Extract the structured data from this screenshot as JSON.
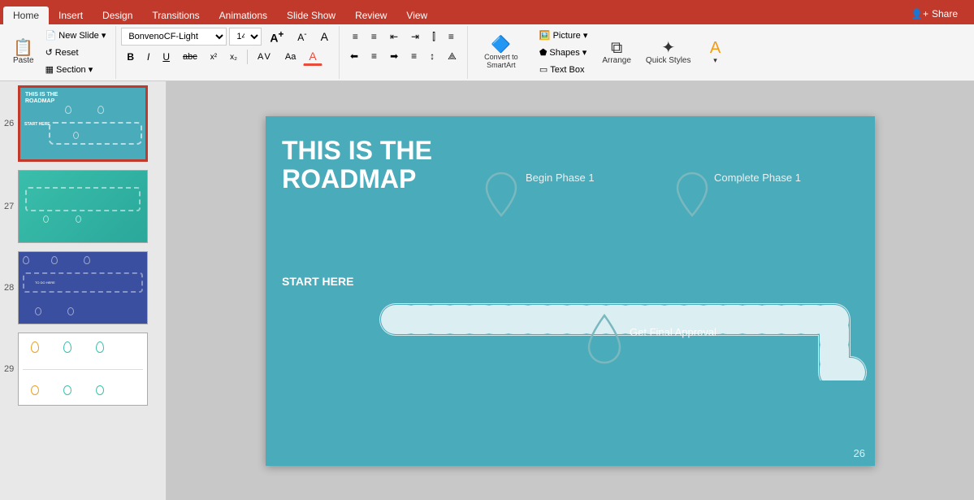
{
  "ribbon": {
    "tabs": [
      "Home",
      "Insert",
      "Design",
      "Transitions",
      "Animations",
      "Slide Show",
      "Review",
      "View"
    ],
    "active_tab": "Home",
    "share_label": "Share"
  },
  "toolbar": {
    "clipboard_group": {
      "paste_label": "Paste",
      "new_slide_label": "New Slide",
      "reset_label": "Reset",
      "section_label": "Section"
    },
    "font_group": {
      "font_name": "BonvenoCF-Light",
      "font_size": "14",
      "font_size_up": "A↑",
      "font_size_down": "A↓",
      "clear_format": "A",
      "bold": "B",
      "italic": "I",
      "underline": "U",
      "strikethrough": "abc",
      "superscript": "x²",
      "subscript": "x₂",
      "char_spacing": "AV",
      "text_case": "Aa",
      "font_color": "A"
    },
    "paragraph_group": {
      "bullets": "≡",
      "numbered": "≡#",
      "indent_less": "←",
      "indent_more": "→"
    },
    "drawing_group": {
      "convert_to_smartart": "Convert to SmartArt",
      "picture_label": "Picture",
      "shapes_label": "Shapes",
      "text_box_label": "Text Box",
      "arrange_label": "Arrange",
      "quick_styles_label": "Quick Styles"
    }
  },
  "slide_panel": {
    "slides": [
      {
        "number": "26",
        "active": true
      },
      {
        "number": "27",
        "active": false
      },
      {
        "number": "28",
        "active": false
      },
      {
        "number": "29",
        "active": false
      }
    ]
  },
  "slide": {
    "number": "26",
    "background_color": "#4aabba",
    "title_line1": "THIS IS THE",
    "title_line2": "ROADMAP",
    "start_here": "START HERE",
    "pins": [
      {
        "id": "pin1",
        "label": "Begin Phase 1"
      },
      {
        "id": "pin2",
        "label": "Complete Phase 1"
      },
      {
        "id": "pin3",
        "label": "Get Final Approval"
      }
    ]
  }
}
